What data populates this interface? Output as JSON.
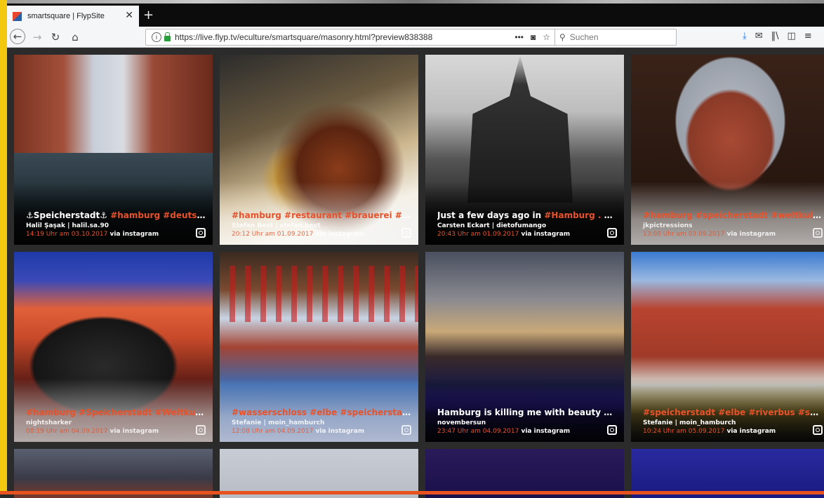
{
  "browser": {
    "tab_title": "smartsquare | FlypSite",
    "tab_close": "✕",
    "new_tab": "+",
    "url": "https://live.flyp.tv/eculture/smartsquare/masonry.html?preview838388",
    "search_placeholder": "Suchen",
    "url_actions": [
      "•••",
      "pocket-icon",
      "bookmark-star-icon"
    ],
    "toolbar_icons": [
      "download-icon",
      "mail-icon",
      "library-icon",
      "sidebar-icon",
      "menu-icon"
    ]
  },
  "colors": {
    "accent": "#e8522a",
    "left_accent": "#f2c811"
  },
  "tiles": [
    {
      "title_plain": "⚓Speicherstadt⚓ ",
      "title_tag": "#hamburg #deutschlan...",
      "author": "Halil Şaşak | halil.sa.90",
      "time": "14:19 Uhr am 03.10.2017",
      "via": " via instagram"
    },
    {
      "title_plain": "",
      "title_tag": "#hamburg #restaurant #brauerei #bayerisch ...",
      "author": "Stefan Best | stefan.best",
      "time": "20:12 Uhr am 01.09.2017",
      "via": " via instagram"
    },
    {
      "title_plain": "Just a few days ago in ",
      "title_tag": "#Hamburg . #petrikirc...",
      "author": "Carsten Eckart | dietofumango",
      "time": "20:43 Uhr am 01.09.2017",
      "via": " via instagram"
    },
    {
      "title_plain": "",
      "title_tag": "#hamburg #speicherstadt #weltkulturerbe #...",
      "author": "jkpictressions",
      "time": "13:00 Uhr am 03.09.2017",
      "via": " via instagram"
    },
    {
      "title_plain": "",
      "title_tag": "#hamburg #Speicherstadt #Weltkulturerbe ...",
      "author": "nightsharker",
      "time": "08:19 Uhr am 04.09.2017",
      "via": " via instagram"
    },
    {
      "title_plain": "",
      "title_tag": "#wasserschloss #elbe #speicherstadt #welt",
      "author": "Stefanie | moin_hamburch",
      "time": "12:08 Uhr am 04.09.2017",
      "via": " via instagram"
    },
    {
      "title_plain": "Hamburg is killing me with beauty every sin...",
      "title_tag": "",
      "author": "novembersun",
      "time": "23:47 Uhr am 04.09.2017",
      "via": " via instagram"
    },
    {
      "title_plain": "",
      "title_tag": "#speicherstadt #elbe #riverbus #sonntag #...",
      "author": "Stefanie | moin_hamburch",
      "time": "10:24 Uhr am 05.09.2017",
      "via": " via instagram"
    }
  ]
}
